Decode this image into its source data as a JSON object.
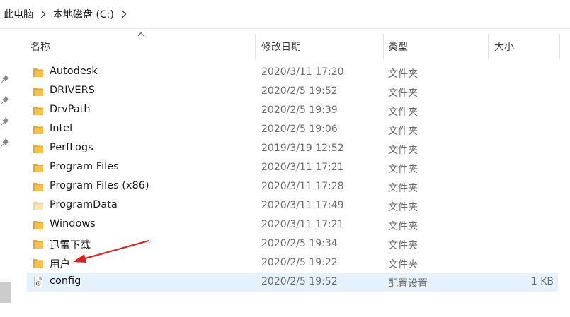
{
  "breadcrumb": {
    "items": [
      "此电脑",
      "本地磁盘 (C:)"
    ],
    "separator_icon": "chevron-right-icon"
  },
  "columns": {
    "name": "名称",
    "modified": "修改日期",
    "type": "类型",
    "size": "大小"
  },
  "files": [
    {
      "name": "Autodesk",
      "modified": "2020/3/11 17:20",
      "type": "文件夹",
      "size": "",
      "icon": "folder-icon"
    },
    {
      "name": "DRIVERS",
      "modified": "2020/2/5 19:52",
      "type": "文件夹",
      "size": "",
      "icon": "folder-icon"
    },
    {
      "name": "DrvPath",
      "modified": "2020/2/5 19:39",
      "type": "文件夹",
      "size": "",
      "icon": "folder-icon"
    },
    {
      "name": "Intel",
      "modified": "2020/2/5 19:06",
      "type": "文件夹",
      "size": "",
      "icon": "folder-icon"
    },
    {
      "name": "PerfLogs",
      "modified": "2019/3/19 12:52",
      "type": "文件夹",
      "size": "",
      "icon": "folder-icon"
    },
    {
      "name": "Program Files",
      "modified": "2020/3/11 17:21",
      "type": "文件夹",
      "size": "",
      "icon": "folder-icon"
    },
    {
      "name": "Program Files (x86)",
      "modified": "2020/3/11 17:28",
      "type": "文件夹",
      "size": "",
      "icon": "folder-icon"
    },
    {
      "name": "ProgramData",
      "modified": "2020/3/11 17:49",
      "type": "文件夹",
      "size": "",
      "icon": "folder-hidden-icon"
    },
    {
      "name": "Windows",
      "modified": "2020/3/11 17:21",
      "type": "文件夹",
      "size": "",
      "icon": "folder-icon"
    },
    {
      "name": "迅雷下载",
      "modified": "2020/2/5 19:34",
      "type": "文件夹",
      "size": "",
      "icon": "folder-icon"
    },
    {
      "name": "用户",
      "modified": "2020/2/5 19:22",
      "type": "文件夹",
      "size": "",
      "icon": "folder-icon"
    },
    {
      "name": "config",
      "modified": "2020/2/5 19:52",
      "type": "配置设置",
      "size": "1 KB",
      "icon": "config-file-icon",
      "selected": true
    }
  ],
  "colors": {
    "folder": "#f6c34a",
    "folder_back": "#e0a93a",
    "folder_hidden": "#f8e6b4",
    "selected_row": "#e5f1fb",
    "annotation_arrow": "#e02020"
  },
  "annotation": {
    "icon": "red-arrow-annotation",
    "points_to": "用户"
  }
}
